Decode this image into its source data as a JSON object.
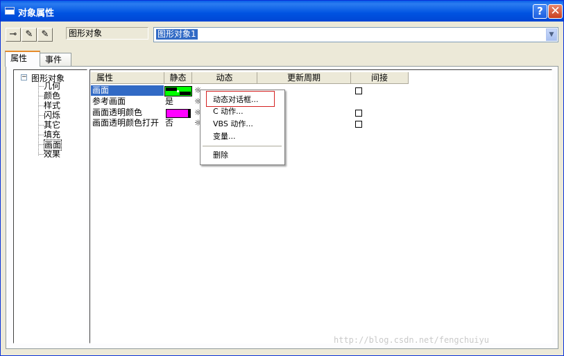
{
  "window": {
    "title": "对象属性",
    "help_label": "?",
    "close_label": "✕"
  },
  "toolbar": {
    "pin_icon": "pin-icon",
    "pipette_icon": "pipette-icon",
    "pipette2_icon": "pipette-copy-icon"
  },
  "object": {
    "type_label": "图形对象",
    "name_value": "图形对象1"
  },
  "tabs": [
    {
      "label": "属性",
      "active": true
    },
    {
      "label": "事件",
      "active": false
    }
  ],
  "tree": {
    "root": "图形对象",
    "items": [
      "几何",
      "颜色",
      "样式",
      "闪烁",
      "其它",
      "填充",
      "画面",
      "效果"
    ],
    "selected": "画面"
  },
  "grid": {
    "headers": [
      "属性",
      "静态",
      "动态",
      "更新周期",
      "间接"
    ],
    "rows": [
      {
        "name": "画面",
        "static": "",
        "selected": true,
        "indirect_checkbox": true
      },
      {
        "name": "参考画面",
        "static": "是",
        "selected": false,
        "indirect_checkbox": false
      },
      {
        "name": "画面透明颜色",
        "static": "",
        "selected": false,
        "indirect_checkbox": true,
        "swatch_color": "#ff00ff"
      },
      {
        "name": "画面透明颜色打开",
        "static": "否",
        "selected": false,
        "indirect_checkbox": true
      }
    ]
  },
  "context_menu": {
    "items": [
      "动态对话框...",
      "C 动作...",
      "VBS 动作...",
      "变量...",
      "删除"
    ],
    "highlighted": "动态对话框..."
  },
  "watermark": "http://blog.csdn.net/fengchuiyu",
  "colors": {
    "titlebar": "#0054e3",
    "selection": "#316ac5",
    "highlight_box": "#d42020",
    "magenta": "#ff00ff",
    "green": "#00ff00"
  }
}
